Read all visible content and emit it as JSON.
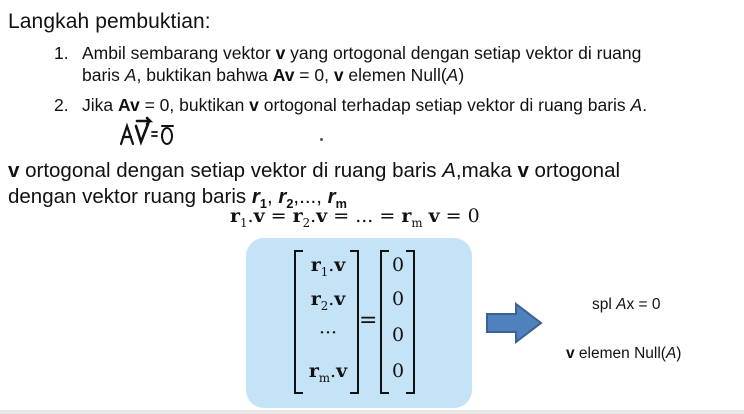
{
  "heading": "Langkah pembuktian:",
  "steps": [
    {
      "number": "1.",
      "line1": "Ambil sembarang vektor v yang ortogonal dengan setiap vektor di ruang",
      "line2": "baris A, buktikan bahwa Av = 0, v elemen Null(A)"
    },
    {
      "number": "2.",
      "line1": "Jika Av = 0, buktikan v ortogonal terhadap setiap vektor di ruang baris A."
    }
  ],
  "handwritten_note": "Av = 0",
  "claim": {
    "line1": "v ortogonal dengan setiap vektor di ruang baris A,maka v ortogonal",
    "line2": "dengan vektor ruang baris r1, r2,..., rm"
  },
  "dot_equation": "r1.v = r2.v = ... = rm v = 0",
  "matrix": {
    "left": [
      "r1.v",
      "r2.v",
      "...",
      "rm.v"
    ],
    "right": [
      "0",
      "0",
      "0",
      "0"
    ],
    "equals": "="
  },
  "conclusion": {
    "line1": "spl Ax = 0",
    "line2": "v elemen Null(A)"
  },
  "colors": {
    "panel": "#c5e3f7",
    "arrow_fill": "#4f81bd",
    "arrow_stroke": "#3a6394"
  }
}
